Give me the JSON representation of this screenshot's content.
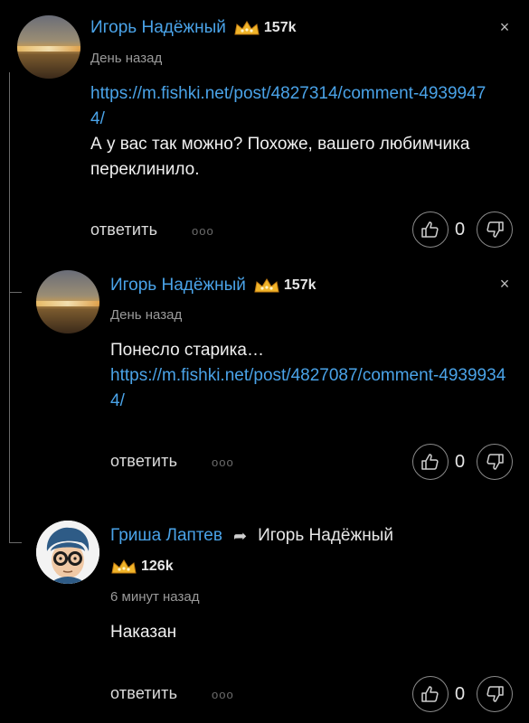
{
  "comments": [
    {
      "author": "Игорь Надёжный",
      "rating": "157k",
      "time": "День назад",
      "link": "https://m.fishki.net/post/4827314/comment-49399474/",
      "text": "А у вас так можно? Похоже, вашего любимчика переклинило.",
      "reply_label": "ответить",
      "more": "ooo",
      "score": "0"
    },
    {
      "author": "Игорь Надёжный",
      "rating": "157k",
      "time": "День назад",
      "text": "Понесло старика…",
      "link": "https://m.fishki.net/post/4827087/comment-49399344/",
      "reply_label": "ответить",
      "more": "ooo",
      "score": "0"
    },
    {
      "author": "Гриша Лаптев",
      "reply_to": "Игорь Надёжный",
      "rating": "126k",
      "time": "6 минут назад",
      "text": "Наказан",
      "reply_label": "ответить",
      "more": "ooo",
      "score": "0"
    }
  ],
  "icons": {
    "close": "×",
    "reply_arrow": "➦"
  },
  "colors": {
    "background": "#000000",
    "author": "#4aa3e8",
    "link": "#4aa3e8",
    "crown": "#f0b429"
  }
}
